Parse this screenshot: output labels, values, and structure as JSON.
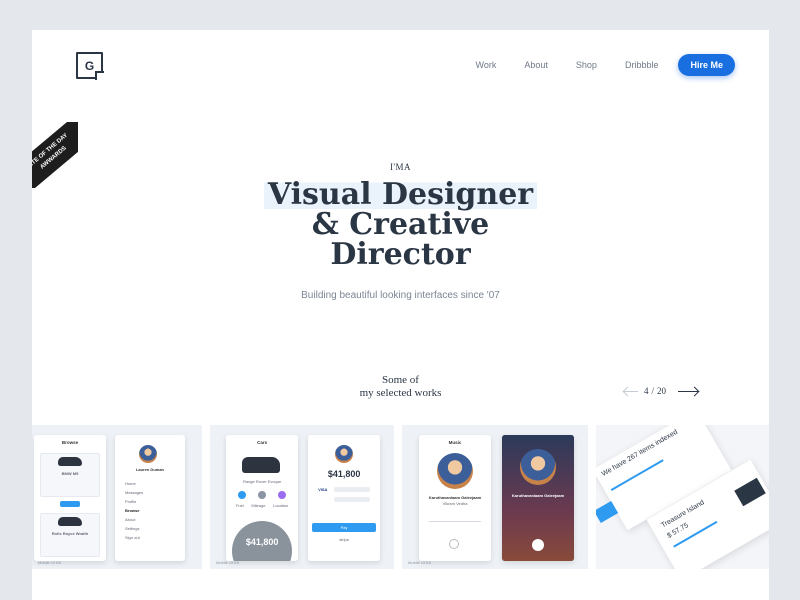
{
  "logo": {
    "letter": "G"
  },
  "nav": {
    "items": [
      "Work",
      "About",
      "Shop",
      "Dribbble"
    ],
    "cta": "Hire Me"
  },
  "badge": {
    "line1": "SITE OF THE DAY",
    "line2": "AWWARDS"
  },
  "hero": {
    "eyebrow": "I'MA",
    "line1": "Visual Designer",
    "line2": "& Creative",
    "line3": "Director",
    "subtitle": "Building beautiful looking interfaces since '07"
  },
  "works": {
    "line1": "Some of",
    "line2": "my selected works",
    "current": "4",
    "total": "20",
    "separator": "/"
  },
  "cards": {
    "card1": {
      "screen1_title": "Browse",
      "car1": "BMW M5",
      "car2": "Rolls Royce Wraith",
      "screen2_name": "Lauren Duman",
      "menu": [
        "Home",
        "Messages",
        "Profile",
        "Browse",
        "About",
        "Settings",
        "Sign out"
      ],
      "tag": "Mobile UI Kit"
    },
    "card2": {
      "screen1_title": "Cars",
      "car_name": "Range Rover Evoque",
      "features": [
        "Fuel",
        "Mileage",
        "Location"
      ],
      "price1": "$41,800",
      "price2": "$41,800",
      "card_visa": "VISA",
      "pay": "Pay",
      "brand": "stripe",
      "tag": "Mobile UI Kit"
    },
    "card3": {
      "screen_title": "Music",
      "artist": "Karuthavanlaam Galeejaam",
      "subtitle": "Vikram Vedha",
      "tag": "Mobile UI Kit"
    },
    "card4": {
      "headline": "We have 267 items indexed",
      "footer": "Treasure Island",
      "amount": "$ 57.75"
    }
  },
  "colors": {
    "accent": "#1a6fe0",
    "background": "#e4e7eb",
    "text": "#2b3645"
  }
}
